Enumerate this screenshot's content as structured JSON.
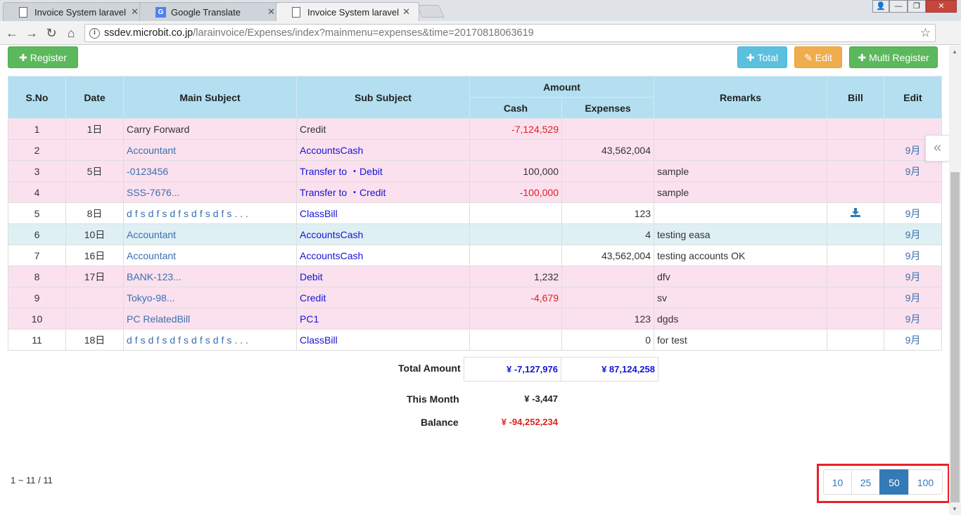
{
  "browser": {
    "tabs": [
      {
        "title": "Invoice System laravel",
        "active": false
      },
      {
        "title": "Google Translate",
        "active": false
      },
      {
        "title": "Invoice System laravel",
        "active": true
      }
    ],
    "url_host": "ssdev.microbit.co.jp",
    "url_path": "/larainvoice/Expenses/index?mainmenu=expenses&time=20170818063619"
  },
  "toolbar": {
    "register_label": "Register",
    "total_label": "Total",
    "edit_label": "Edit",
    "multi_register_label": "Multi Register"
  },
  "table": {
    "headers": {
      "sno": "S.No",
      "date": "Date",
      "main_subject": "Main Subject",
      "sub_subject": "Sub Subject",
      "amount": "Amount",
      "cash": "Cash",
      "expenses": "Expenses",
      "remarks": "Remarks",
      "bill": "Bill",
      "edit": "Edit"
    },
    "rows": [
      {
        "sno": "1",
        "date": "1日",
        "main": "Carry Forward",
        "sub": "Credit",
        "cash": "-7,124,529",
        "expenses": "",
        "remarks": "",
        "bill": "",
        "edit": ""
      },
      {
        "sno": "2",
        "date": "",
        "main": "Accountant",
        "sub": "AccountsCash",
        "cash": "",
        "expenses": "43,562,004",
        "remarks": "",
        "bill": "",
        "edit": "9月"
      },
      {
        "sno": "3",
        "date": "5日",
        "main": "-0123456",
        "sub": "Transfer to ・Debit",
        "cash": "100,000",
        "expenses": "",
        "remarks": "sample",
        "bill": "",
        "edit": "9月"
      },
      {
        "sno": "4",
        "date": "",
        "main": "SSS-7676...",
        "sub": "Transfer to ・Credit",
        "cash": "-100,000",
        "expenses": "",
        "remarks": "sample",
        "bill": "",
        "edit": ""
      },
      {
        "sno": "5",
        "date": "8日",
        "main": "dfsdfsdfsdfsdfs...",
        "sub": "ClassBill",
        "cash": "",
        "expenses": "123",
        "remarks": "",
        "bill": "download-icon",
        "edit": "9月"
      },
      {
        "sno": "6",
        "date": "10日",
        "main": "Accountant",
        "sub": "AccountsCash",
        "cash": "",
        "expenses": "4",
        "remarks": "testing easa",
        "bill": "",
        "edit": "9月"
      },
      {
        "sno": "7",
        "date": "16日",
        "main": "Accountant",
        "sub": "AccountsCash",
        "cash": "",
        "expenses": "43,562,004",
        "remarks": "testing accounts OK",
        "bill": "",
        "edit": "9月"
      },
      {
        "sno": "8",
        "date": "17日",
        "main": "BANK-123...",
        "sub": "Debit",
        "cash": "1,232",
        "expenses": "",
        "remarks": "dfv",
        "bill": "",
        "edit": "9月"
      },
      {
        "sno": "9",
        "date": "",
        "main": "Tokyo-98...",
        "sub": "Credit",
        "cash": "-4,679",
        "expenses": "",
        "remarks": "sv",
        "bill": "",
        "edit": "9月"
      },
      {
        "sno": "10",
        "date": "",
        "main": "PC RelatedBill",
        "sub": "PC1",
        "cash": "",
        "expenses": "123",
        "remarks": "dgds",
        "bill": "",
        "edit": "9月"
      },
      {
        "sno": "11",
        "date": "18日",
        "main": "dfsdfsdfsdfsdfs...",
        "sub": "ClassBill",
        "cash": "",
        "expenses": "0",
        "remarks": "for test",
        "bill": "",
        "edit": "9月"
      }
    ]
  },
  "summary": {
    "total_amount_label": "Total Amount",
    "total_cash": "¥ -7,127,976",
    "total_expenses": "¥ 87,124,258",
    "this_month_label": "This Month",
    "this_month_value": "¥ -3,447",
    "balance_label": "Balance",
    "balance_value": "¥ -94,252,234"
  },
  "pagination": {
    "info": "1 ~ 11 / 11",
    "options": [
      "10",
      "25",
      "50",
      "100"
    ],
    "selected": "50"
  },
  "colors": {
    "header_bg": "#b3dff0",
    "row_pink": "#fbe1ee",
    "row_info": "#dff0f4",
    "negative": "#e02020",
    "highlight_box": "#e8212b"
  }
}
